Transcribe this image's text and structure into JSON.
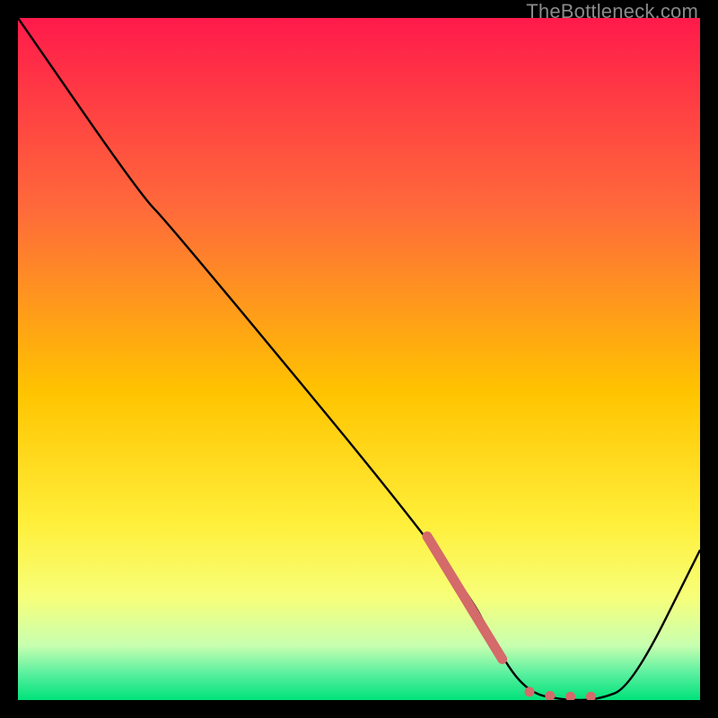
{
  "watermark": "TheBottleneck.com",
  "colors": {
    "gradient_top": "#ff1a4b",
    "gradient_mid1": "#ff7a3a",
    "gradient_mid2": "#ffd400",
    "gradient_mid3": "#fff65a",
    "gradient_bottom": "#00e27a",
    "curve": "#000000",
    "highlight": "#d46a6a",
    "frame_bg": "#000000"
  },
  "chart_data": {
    "type": "line",
    "title": "",
    "xlabel": "",
    "ylabel": "",
    "xlim": [
      0,
      100
    ],
    "ylim": [
      0,
      100
    ],
    "grid": false,
    "legend": false,
    "series": [
      {
        "name": "bottleneck-curve",
        "x": [
          0,
          18,
          22,
          65,
          71,
          75,
          80,
          85,
          90,
          100
        ],
        "values": [
          100,
          74,
          70,
          18,
          6,
          1,
          0,
          0,
          2,
          22
        ]
      }
    ],
    "highlight_segment": {
      "name": "optimal-range",
      "x": [
        60,
        71,
        75,
        78,
        81,
        84
      ],
      "values": [
        24,
        6,
        1.2,
        0.6,
        0.5,
        0.5
      ]
    }
  }
}
